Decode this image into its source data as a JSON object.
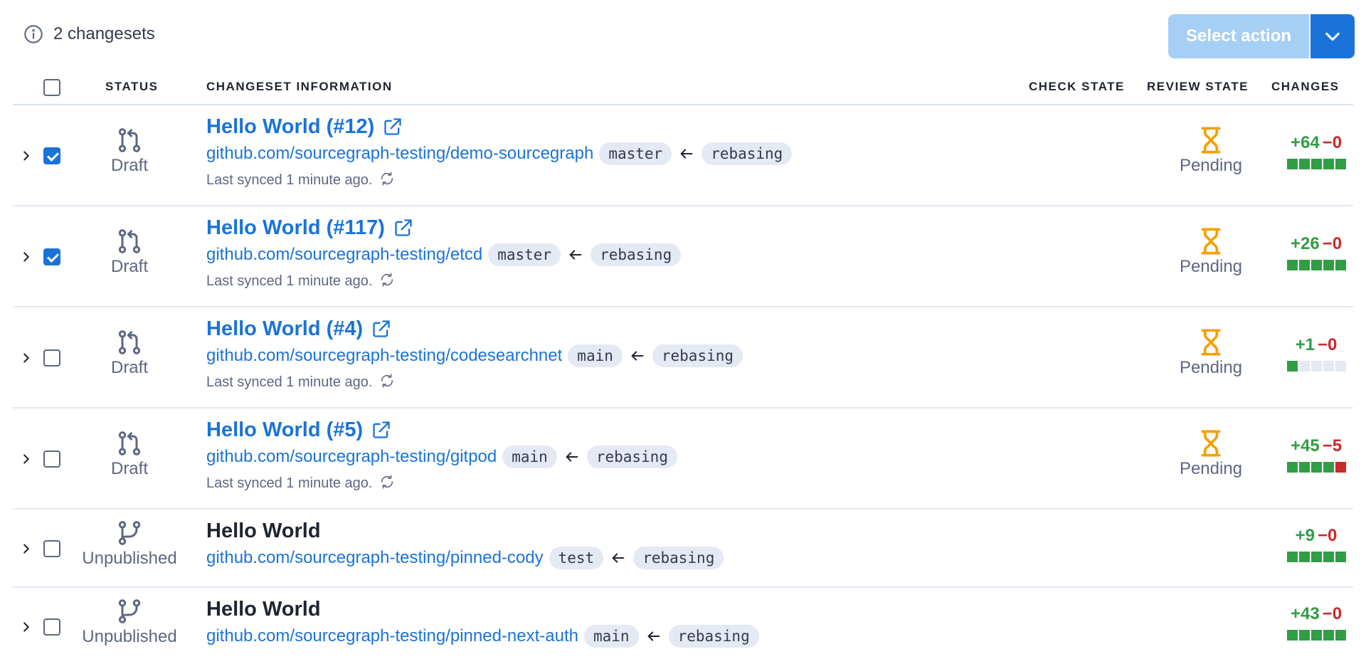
{
  "summary": {
    "count_text": "2 changesets"
  },
  "action": {
    "label": "Select action"
  },
  "columns": {
    "status": "STATUS",
    "info": "CHANGESET INFORMATION",
    "check": "CHECK STATE",
    "review": "REVIEW STATE",
    "changes": "CHANGES"
  },
  "colors": {
    "link": "#1a73d9",
    "added": "#2f9e44",
    "removed": "#c92a2a",
    "pending": "#f59f00",
    "empty_block": "#e4e9f4"
  },
  "rows": [
    {
      "checked": true,
      "status": "Draft",
      "status_icon": "pull-request-icon",
      "title": "Hello World (#12)",
      "external": true,
      "repo": "github.com/sourcegraph-testing/demo-sourcegraph",
      "base_branch": "master",
      "head_branch": "rebasing",
      "synced": "Last synced 1 minute ago.",
      "review": "Pending",
      "added": "+64",
      "removed": "−0",
      "diff_blocks": [
        "added",
        "added",
        "added",
        "added",
        "added"
      ]
    },
    {
      "checked": true,
      "status": "Draft",
      "status_icon": "pull-request-icon",
      "title": "Hello World (#117)",
      "external": true,
      "repo": "github.com/sourcegraph-testing/etcd",
      "base_branch": "master",
      "head_branch": "rebasing",
      "synced": "Last synced 1 minute ago.",
      "review": "Pending",
      "added": "+26",
      "removed": "−0",
      "diff_blocks": [
        "added",
        "added",
        "added",
        "added",
        "added"
      ]
    },
    {
      "checked": false,
      "status": "Draft",
      "status_icon": "pull-request-icon",
      "title": "Hello World (#4)",
      "external": true,
      "repo": "github.com/sourcegraph-testing/codesearchnet",
      "base_branch": "main",
      "head_branch": "rebasing",
      "synced": "Last synced 1 minute ago.",
      "review": "Pending",
      "added": "+1",
      "removed": "−0",
      "diff_blocks": [
        "added",
        "empty",
        "empty",
        "empty",
        "empty"
      ]
    },
    {
      "checked": false,
      "status": "Draft",
      "status_icon": "pull-request-icon",
      "title": "Hello World (#5)",
      "external": true,
      "repo": "github.com/sourcegraph-testing/gitpod",
      "base_branch": "main",
      "head_branch": "rebasing",
      "synced": "Last synced 1 minute ago.",
      "review": "Pending",
      "added": "+45",
      "removed": "−5",
      "diff_blocks": [
        "added",
        "added",
        "added",
        "added",
        "removed"
      ]
    },
    {
      "checked": false,
      "status": "Unpublished",
      "status_icon": "branch-icon",
      "title": "Hello World",
      "external": false,
      "repo": "github.com/sourcegraph-testing/pinned-cody",
      "base_branch": "test",
      "head_branch": "rebasing",
      "synced": "",
      "review": "",
      "added": "+9",
      "removed": "−0",
      "diff_blocks": [
        "added",
        "added",
        "added",
        "added",
        "added"
      ]
    },
    {
      "checked": false,
      "status": "Unpublished",
      "status_icon": "branch-icon",
      "title": "Hello World",
      "external": false,
      "repo": "github.com/sourcegraph-testing/pinned-next-auth",
      "base_branch": "main",
      "head_branch": "rebasing",
      "synced": "",
      "review": "",
      "added": "+43",
      "removed": "−0",
      "diff_blocks": [
        "added",
        "added",
        "added",
        "added",
        "added"
      ]
    }
  ]
}
